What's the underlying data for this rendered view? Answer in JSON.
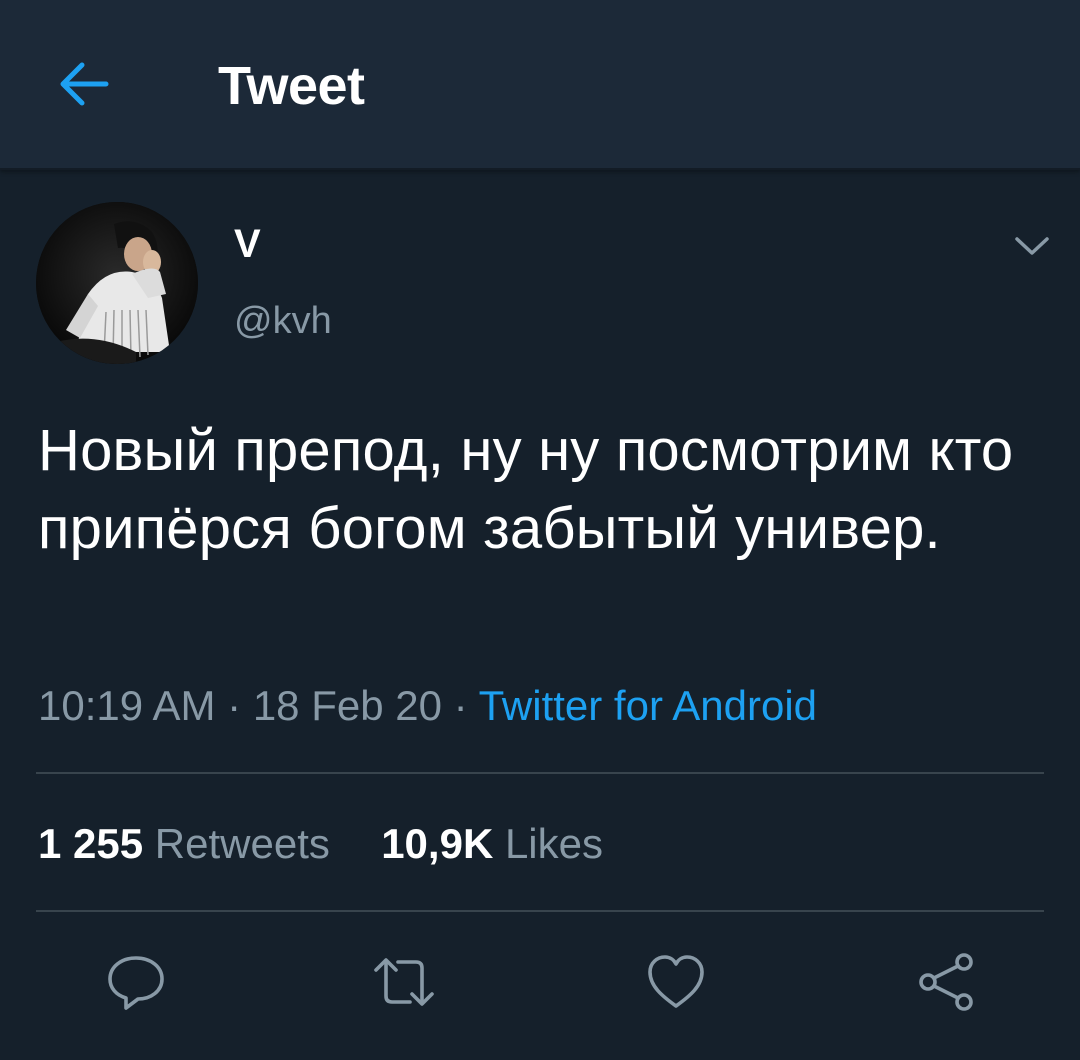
{
  "header": {
    "title": "Tweet",
    "back_icon": "arrow-left-icon",
    "accent": "#1da1f2"
  },
  "tweet": {
    "author": {
      "display_name": "V",
      "handle": "@kvh",
      "avatar": "user-avatar-photo"
    },
    "text": "Новый препод, ну ну посмотрим кто припёрся богом забытый универ.",
    "time": "10:19 AM",
    "separator": "·",
    "date": "18 Feb 20",
    "source": "Twitter for Android",
    "stats": {
      "retweets_count": "1 255",
      "retweets_label": "Retweets",
      "likes_count": "10,9K",
      "likes_label": "Likes"
    },
    "actions": [
      {
        "name": "reply",
        "icon": "reply-bubble-icon"
      },
      {
        "name": "retweet",
        "icon": "retweet-icon"
      },
      {
        "name": "like",
        "icon": "heart-icon"
      },
      {
        "name": "share",
        "icon": "share-icon"
      }
    ]
  },
  "colors": {
    "background": "#15202b",
    "header_background": "#1c2938",
    "secondary_text": "#8899a6",
    "divider": "#38444d",
    "link": "#1da1f2"
  }
}
